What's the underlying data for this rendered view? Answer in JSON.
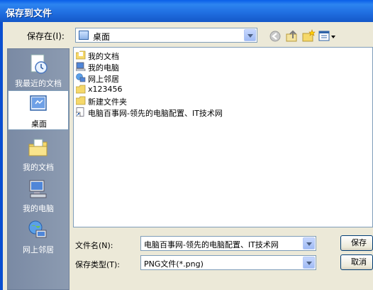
{
  "window": {
    "title": "保存到文件"
  },
  "toolbar": {
    "save_in_label": "保存在(I):",
    "save_in_value": "桌面"
  },
  "places": [
    {
      "label": "我最近的文档",
      "icon": "recent-documents-icon"
    },
    {
      "label": "桌面",
      "icon": "desktop-icon"
    },
    {
      "label": "我的文档",
      "icon": "my-documents-icon"
    },
    {
      "label": "我的电脑",
      "icon": "my-computer-icon"
    },
    {
      "label": "网上邻居",
      "icon": "network-places-icon"
    }
  ],
  "files": [
    {
      "name": "我的文档",
      "icon": "my-documents-icon"
    },
    {
      "name": "我的电脑",
      "icon": "my-computer-icon"
    },
    {
      "name": "网上邻居",
      "icon": "network-places-icon"
    },
    {
      "name": "x123456",
      "icon": "folder-icon"
    },
    {
      "name": "新建文件夹",
      "icon": "folder-icon"
    },
    {
      "name": "电脑百事网-领先的电脑配置、IT技术网",
      "icon": "shortcut-icon"
    }
  ],
  "form": {
    "filename_label": "文件名(N):",
    "filename_value": "电脑百事网-领先的电脑配置、IT技术网",
    "filetype_label": "保存类型(T):",
    "filetype_value": "PNG文件(*.png)",
    "save_button": "保存",
    "cancel_button": "取消"
  },
  "colors": {
    "titlebar": "#1f6de0",
    "places_bg": "#8c9bb1",
    "dialog_bg": "#ece9d8"
  }
}
